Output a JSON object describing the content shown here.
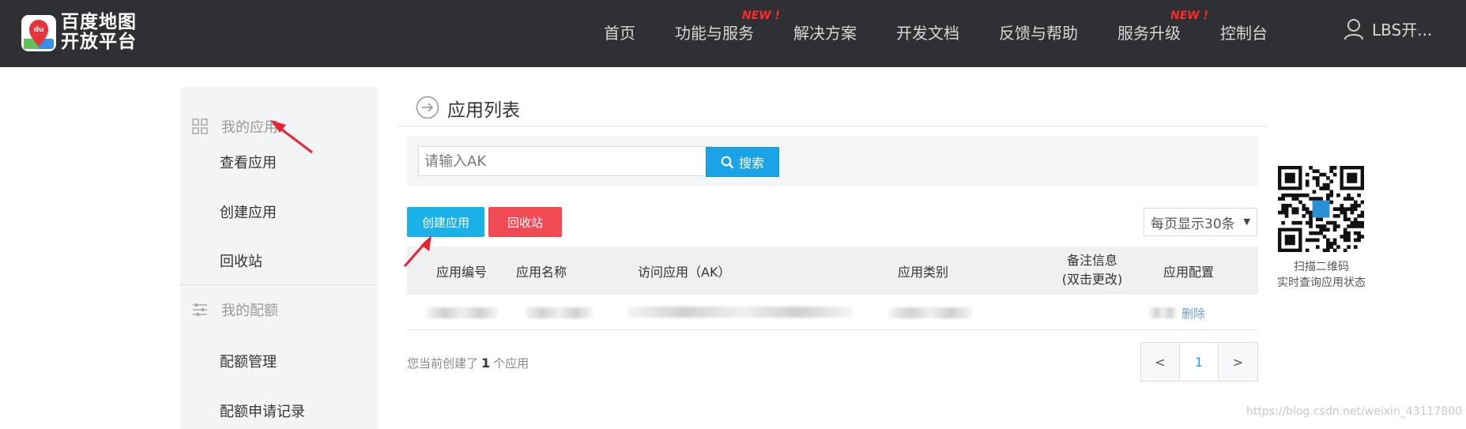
{
  "header": {
    "logo_text_line1": "百度地图",
    "logo_text_line2": "开放平台",
    "nav": [
      {
        "label": "首页"
      },
      {
        "label": "功能与服务",
        "badge": "NEW !"
      },
      {
        "label": "解决方案"
      },
      {
        "label": "开发文档"
      },
      {
        "label": "反馈与帮助"
      },
      {
        "label": "服务升级",
        "badge": "NEW !"
      },
      {
        "label": "控制台"
      }
    ],
    "user": "LBS开..."
  },
  "sidebar": {
    "group1": "我的应用",
    "items1": [
      {
        "label": "查看应用"
      },
      {
        "label": "创建应用"
      },
      {
        "label": "回收站"
      }
    ],
    "group2": "我的配额",
    "items2": [
      {
        "label": "配额管理"
      },
      {
        "label": "配额申请记录"
      }
    ]
  },
  "main": {
    "title": "应用列表",
    "search": {
      "placeholder": "请输入AK",
      "button": "搜索"
    },
    "create_button": "创建应用",
    "recycle_button": "回收站",
    "per_page": "每页显示30条",
    "table": {
      "columns": [
        "应用编号",
        "应用名称",
        "访问应用（AK）",
        "应用类别",
        "备注信息",
        "(双击更改)",
        "应用配置"
      ],
      "row_action_delete": "删除"
    },
    "summary": {
      "prefix": "您当前创建了",
      "count": "1",
      "suffix": "个应用"
    },
    "pagination": {
      "prev": "<",
      "current": "1",
      "next": ">"
    }
  },
  "qr": {
    "line1": "扫描二维码",
    "line2": "实时查询应用状态"
  },
  "watermark": "https://blog.csdn.net/weixin_43117800",
  "colors": {
    "topbar": "#2e3033",
    "accent": "#1aa3e6",
    "danger": "#f04a55",
    "new_badge": "#ff2a2a"
  }
}
